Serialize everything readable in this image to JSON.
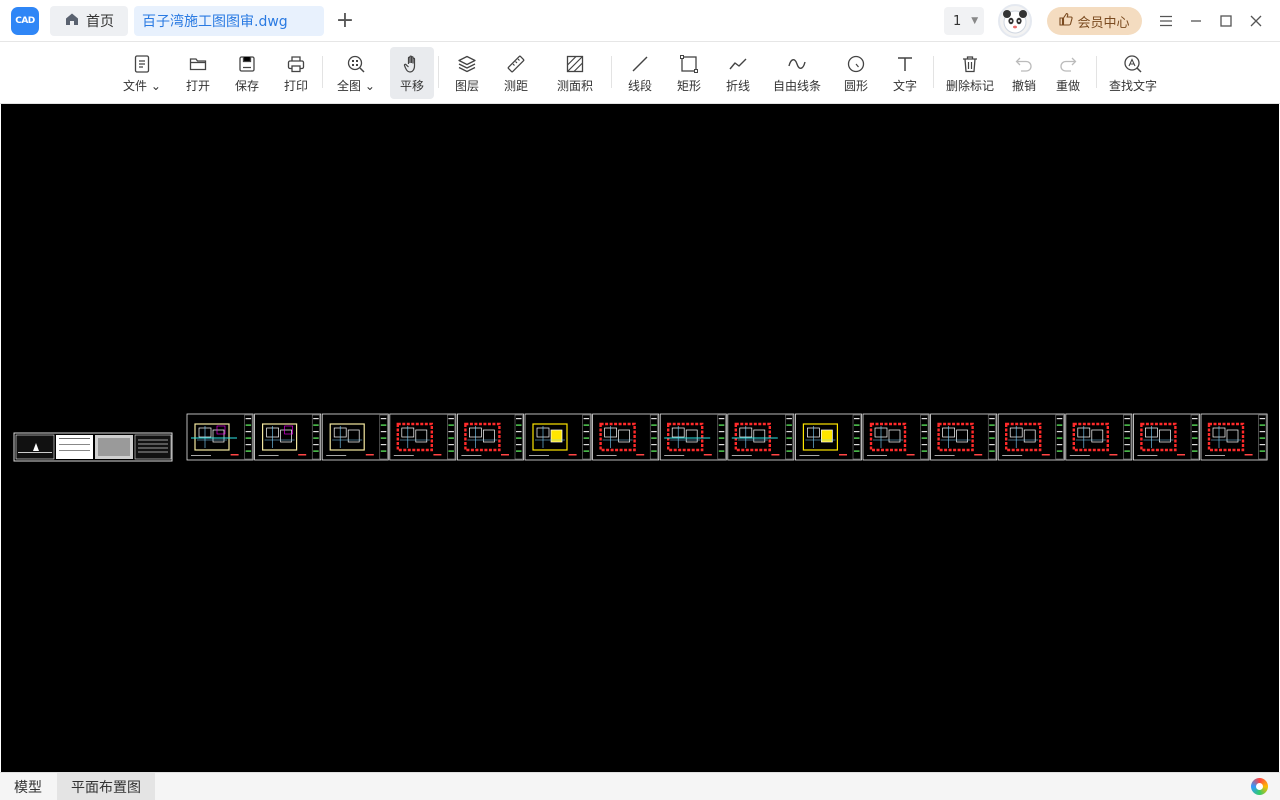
{
  "app": {
    "logo_text": "CAD",
    "home_tab": "首页",
    "file_tab": "百子湾施工图图审.dwg",
    "new_tab_symbol": "+",
    "page_number": "1",
    "vip_label": "会员中心"
  },
  "toolbar": {
    "file": "文件",
    "open": "打开",
    "save": "保存",
    "print": "打印",
    "full_view": "全图",
    "pan": "平移",
    "layers": "图层",
    "measure_distance": "测距",
    "measure_area": "测面积",
    "line": "线段",
    "rectangle": "矩形",
    "polyline": "折线",
    "freehand": "自由线条",
    "circle": "圆形",
    "text": "文字",
    "delete_marks": "删除标记",
    "undo": "撤销",
    "redo": "重做",
    "find_text": "查找文字"
  },
  "status_bar": {
    "tabs": [
      "模型",
      "平面布置图"
    ],
    "active_tab": 1
  },
  "colors": {
    "accent": "#2f86f6",
    "canvas_background": "#000000",
    "vip_background": "#f4dcc0"
  }
}
